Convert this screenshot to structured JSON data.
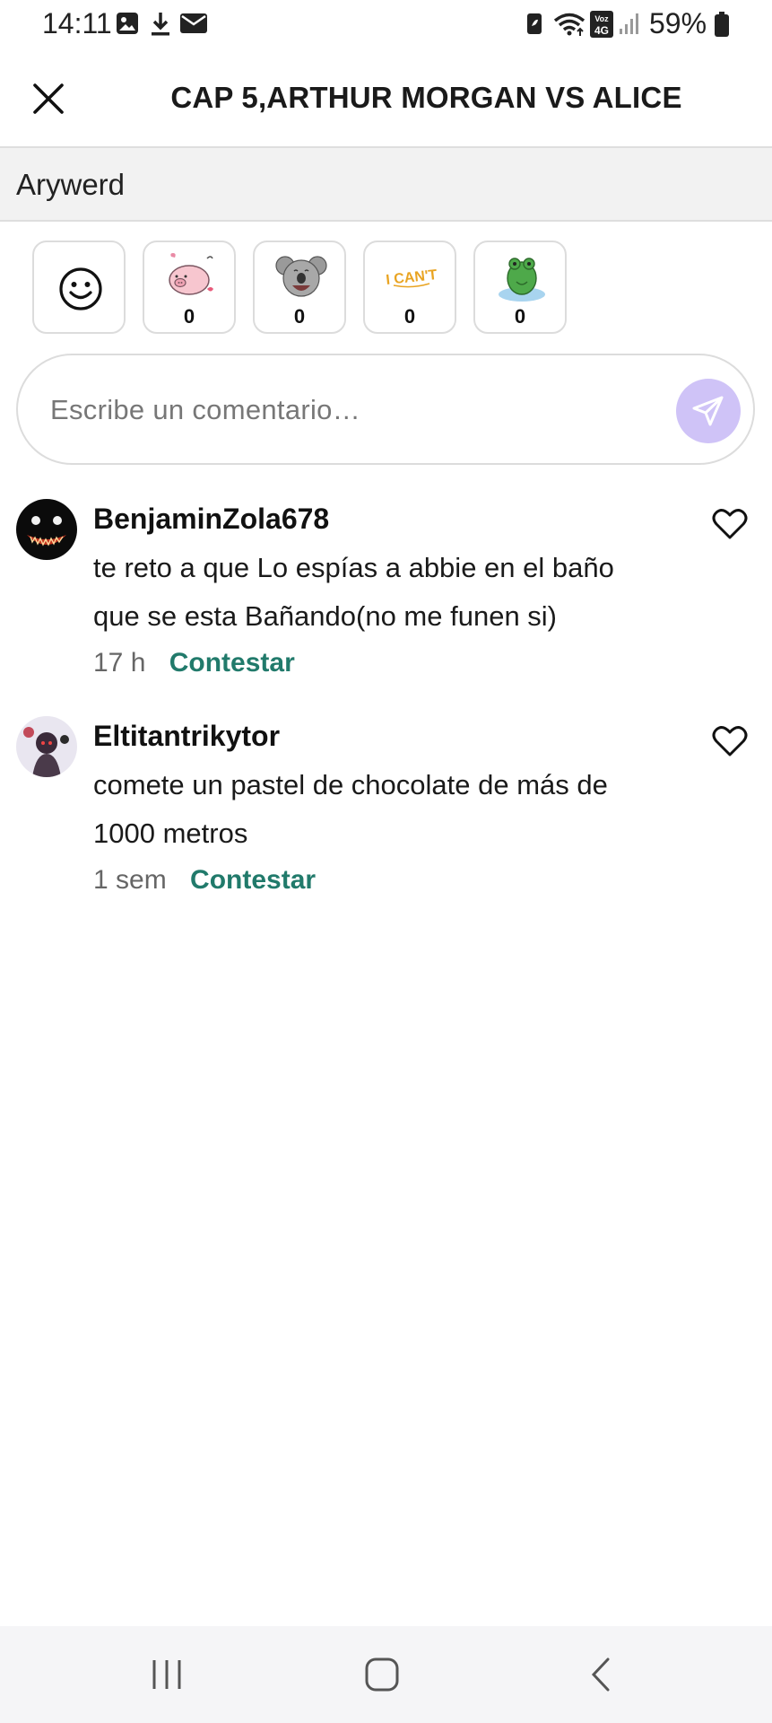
{
  "status_bar": {
    "time": "14:11",
    "battery": "59%",
    "icons": [
      "gallery-icon",
      "download-icon",
      "mail-icon",
      "battery-saver-icon",
      "wifi-icon",
      "volte-icon",
      "signal-icon",
      "battery-icon"
    ],
    "volte_label": "Voz 4G"
  },
  "header": {
    "title": "CAP 5,ARTHUR MORGAN VS ALICE",
    "close_icon": "close-icon"
  },
  "author": {
    "name": "Arywerd"
  },
  "reactions": [
    {
      "name": "smiley-icon",
      "count": null
    },
    {
      "name": "pig-sticker",
      "count": "0"
    },
    {
      "name": "koala-sticker",
      "count": "0"
    },
    {
      "name": "i-cant-sticker",
      "count": "0",
      "text": "I CAN'T"
    },
    {
      "name": "frog-sticker",
      "count": "0"
    }
  ],
  "comment_input": {
    "placeholder": "Escribe un comentario…",
    "send_icon": "send-icon"
  },
  "comments": [
    {
      "user": "BenjaminZola678",
      "text": "te reto a que Lo espías a abbie en el baño que se esta Bañando(no me funen si)",
      "time": "17 h",
      "reply": "Contestar"
    },
    {
      "user": "Eltitantrikytor",
      "text": "comete un pastel de chocolate de más de 1000 metros",
      "time": "1 sem",
      "reply": "Contestar"
    }
  ],
  "colors": {
    "accent": "#217a6b",
    "send_button": "#cfc3f7",
    "author_bar": "#f2f2f2"
  }
}
